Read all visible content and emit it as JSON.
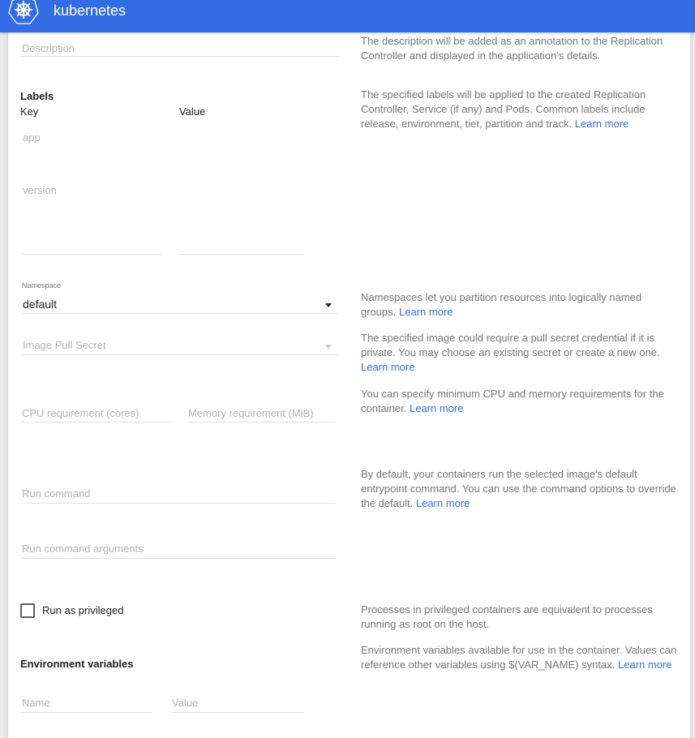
{
  "header": {
    "app_title": "kubernetes",
    "logo_icon": "kubernetes-helm-icon",
    "brand_color": "#326de6"
  },
  "form": {
    "description": {
      "placeholder": "Description",
      "help": "The description will be added as an annotation to the Replication Controller and displayed in the application's details."
    },
    "labels": {
      "title": "Labels",
      "key_header": "Key",
      "value_header": "Value",
      "rows": [
        {
          "key": "app",
          "value": ""
        },
        {
          "key": "version",
          "value": ""
        },
        {
          "key": "",
          "value": ""
        }
      ],
      "help": "The specified labels will be applied to the created Replication Controller, Service (if any) and Pods. Common labels include release, environment, tier, partition and track.",
      "help_link": "Learn more"
    },
    "namespace": {
      "label": "Namespace",
      "value": "default",
      "help": "Namespaces let you partition resources into logically named groups.",
      "help_link": "Learn more"
    },
    "image_pull_secret": {
      "placeholder": "Image Pull Secret",
      "help": "The specified image could require a pull secret credential if it is private. You may choose an existing secret or create a new one.",
      "help_link": "Learn more"
    },
    "resources": {
      "cpu_placeholder": "CPU requirement (cores)",
      "memory_placeholder": "Memory requirement (MiB)",
      "help": "You can specify minimum CPU and memory requirements for the container.",
      "help_link": "Learn more"
    },
    "run_command": {
      "placeholder": "Run command",
      "args_placeholder": "Run command arguments",
      "help": "By default, your containers run the selected image's default entrypoint command. You can use the command options to override the default.",
      "help_link": "Learn more"
    },
    "privileged": {
      "label": "Run as privileged",
      "checked": false,
      "help": "Processes in privileged containers are equivalent to processes running as root on the host."
    },
    "env_vars": {
      "title": "Environment variables",
      "name_placeholder": "Name",
      "value_placeholder": "Value",
      "help": "Environment variables available for use in the container. Values can reference other variables using $(VAR_NAME) syntax.",
      "help_link": "Learn more"
    }
  }
}
